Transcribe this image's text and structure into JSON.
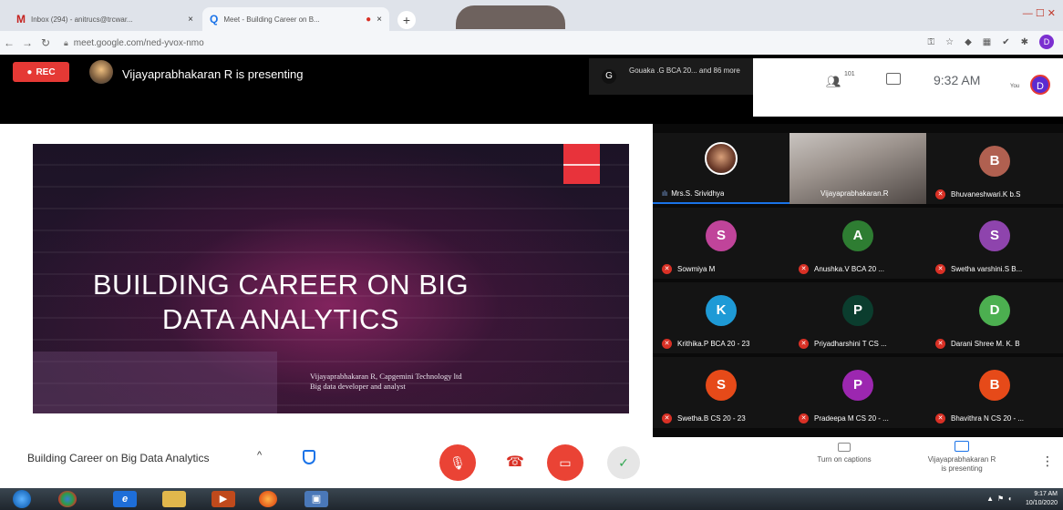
{
  "browser": {
    "tabs": [
      {
        "icon": "M",
        "title": "Inbox (294) - anitrucs@trcwar...",
        "close": "×"
      },
      {
        "icon": "Q",
        "title": "Meet - Building Career on B...",
        "close": "×"
      }
    ],
    "new_tab": "+",
    "url": "meet.google.com/ned-yvox-nmo"
  },
  "meet": {
    "rec_label": "REC",
    "presenting_label": "Vijayaprabhakaran R is presenting",
    "chat_avatar": "G",
    "chat_preview": "Gouaka .G BCA 20... and 86 more",
    "people_count": "101",
    "clock": "9:32 AM",
    "you_label": "You",
    "self_initial": "D"
  },
  "slide": {
    "title_line1": "BUILDING CAREER ON BIG",
    "title_line2": "DATA ANALYTICS",
    "subtitle_line1": "Vijayaprabhakaran R, Capgemini Technology ltd",
    "subtitle_line2": "Big data developer and analyst"
  },
  "participants": [
    {
      "name": "Mrs.S. Srividhya",
      "type": "photo",
      "mic": "wave",
      "active": true
    },
    {
      "name": "Vijayaprabhakaran.R",
      "type": "video",
      "mic": "none"
    },
    {
      "name": "Bhuvaneshwari.K b.S",
      "initial": "B",
      "color": "#b06050",
      "mic": "muted"
    },
    {
      "name": "Sowmiya M",
      "initial": "S",
      "color": "#c0449a",
      "mic": "muted"
    },
    {
      "name": "Anushka.V BCA 20 ...",
      "initial": "A",
      "color": "#2e7d32",
      "mic": "muted"
    },
    {
      "name": "Swetha varshini.S B...",
      "initial": "S",
      "color": "#8e44ad",
      "mic": "muted"
    },
    {
      "name": "Krithika.P BCA 20 - 23",
      "initial": "K",
      "color": "#1e9ad6",
      "mic": "muted"
    },
    {
      "name": "Priyadharshini T CS ...",
      "initial": "P",
      "color": "#0b3d2e",
      "mic": "muted"
    },
    {
      "name": "Darani Shree M. K. B",
      "initial": "D",
      "color": "#4caf50",
      "mic": "muted"
    },
    {
      "name": "Swetha.B CS 20 - 23",
      "initial": "S",
      "color": "#e64a19",
      "mic": "muted"
    },
    {
      "name": "Pradeepa M CS 20 - ...",
      "initial": "P",
      "color": "#9c27b0",
      "mic": "muted"
    },
    {
      "name": "Bhavithra N CS 20 - ...",
      "initial": "B",
      "color": "#e64a19",
      "mic": "muted"
    }
  ],
  "bottom_bar": {
    "meeting_title": "Building Career on Big Data Analytics",
    "caret": "^",
    "captions_label": "Turn on captions",
    "presenting_line1": "Vijayaprabhakaran R",
    "presenting_line2": "is presenting",
    "more": "⋮"
  },
  "taskbar": {
    "time": "9:17 AM",
    "date": "10/10/2020"
  }
}
